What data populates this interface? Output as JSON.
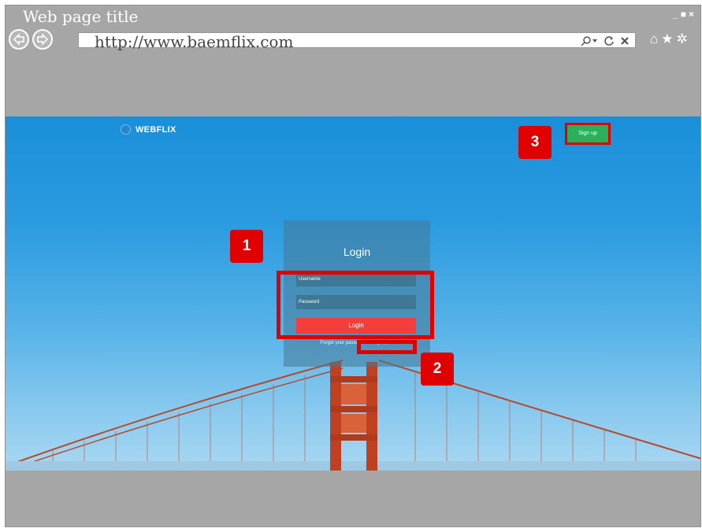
{
  "window": {
    "title": "Web page title",
    "controls": [
      "_",
      "■",
      "×"
    ]
  },
  "browser": {
    "url": "http://www.baemflix.com",
    "addr_icons": [
      "search-dropdown-icon",
      "refresh-icon",
      "stop-icon"
    ],
    "toolbar_icons": [
      "home-icon",
      "favorites-icon",
      "settings-icon"
    ]
  },
  "site": {
    "brand": "WEBFLIX",
    "signup_label": "Sign up",
    "login": {
      "title": "Login",
      "username_placeholder": "Username",
      "password_placeholder": "Password",
      "button_label": "Login",
      "forgot_text": "Forgot your password?",
      "forgot_link": "Forget pwd"
    }
  },
  "annotations": {
    "badge1": "1",
    "badge2": "2",
    "badge3": "3"
  },
  "colors": {
    "highlight": "#e00000",
    "login_button": "#f43d3d",
    "signup_button": "#29b05a"
  }
}
